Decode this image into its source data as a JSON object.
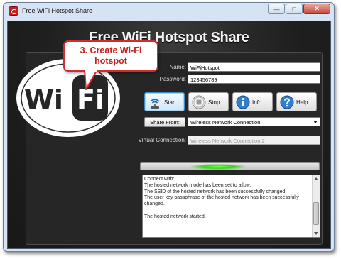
{
  "window": {
    "title": "Free WiFi Hotspot Share",
    "controls": {
      "minimize": "—",
      "maximize": "□",
      "close": "✕"
    }
  },
  "main": {
    "heading": "Free WiFi Hotspot Share",
    "logo": {
      "text_left": "Wi",
      "text_right": "Fi"
    }
  },
  "form": {
    "name_label": "Name:",
    "name_value": "WiFiHotspot",
    "password_label": "Password:",
    "password_value": "123456789",
    "share_from_button": "Share From:",
    "share_from_value": "Wireless Network Connection",
    "virtual_connection_label": "Virtual Connection:",
    "virtual_connection_value": "Wireless Network Connection 2"
  },
  "actions": {
    "start": "Start",
    "stop": "Stop",
    "info": "Info",
    "help": "Help"
  },
  "log": {
    "lines": [
      "Connect with:",
      "The hosted network mode has been set to allow.",
      "The SSID of the hosted network has been successfully changed.",
      "The user key passphrase of the hosted network has been successfully changed.",
      "",
      "The hosted network started."
    ]
  },
  "callout": {
    "line1": "3. Create Wi-Fi",
    "line2": "hotspot"
  },
  "colors": {
    "callout_red": "#c81e1e",
    "background_dark": "#1f1f1f",
    "progress_green": "#39d31c"
  }
}
